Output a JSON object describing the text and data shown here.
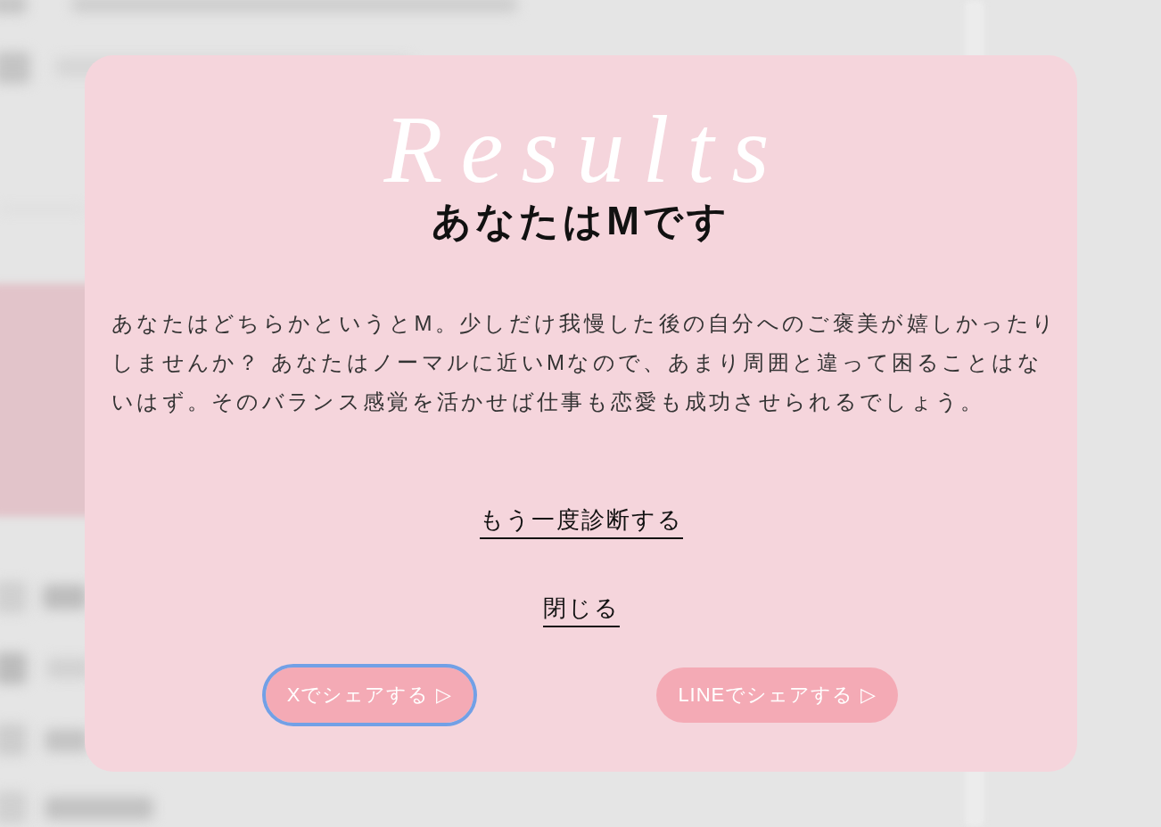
{
  "dialog": {
    "decoration": "Results",
    "title": "あなたはMです",
    "description": "あなたはどちらかというとM。少しだけ我慢した後の自分へのご褒美が嬉しかったりしませんか？ あなたはノーマルに近いMなので、あまり周囲と違って困ることはないはず。そのバランス感覚を活かせば仕事も恋愛も成功させられるでしょう。",
    "links": [
      "もう一度診断する",
      "閉じる"
    ],
    "share_buttons": [
      {
        "label": "Xでシェアする",
        "arrow": "▷",
        "focused": true
      },
      {
        "label": "LINEでシェアする",
        "arrow": "▷",
        "focused": false
      }
    ]
  }
}
